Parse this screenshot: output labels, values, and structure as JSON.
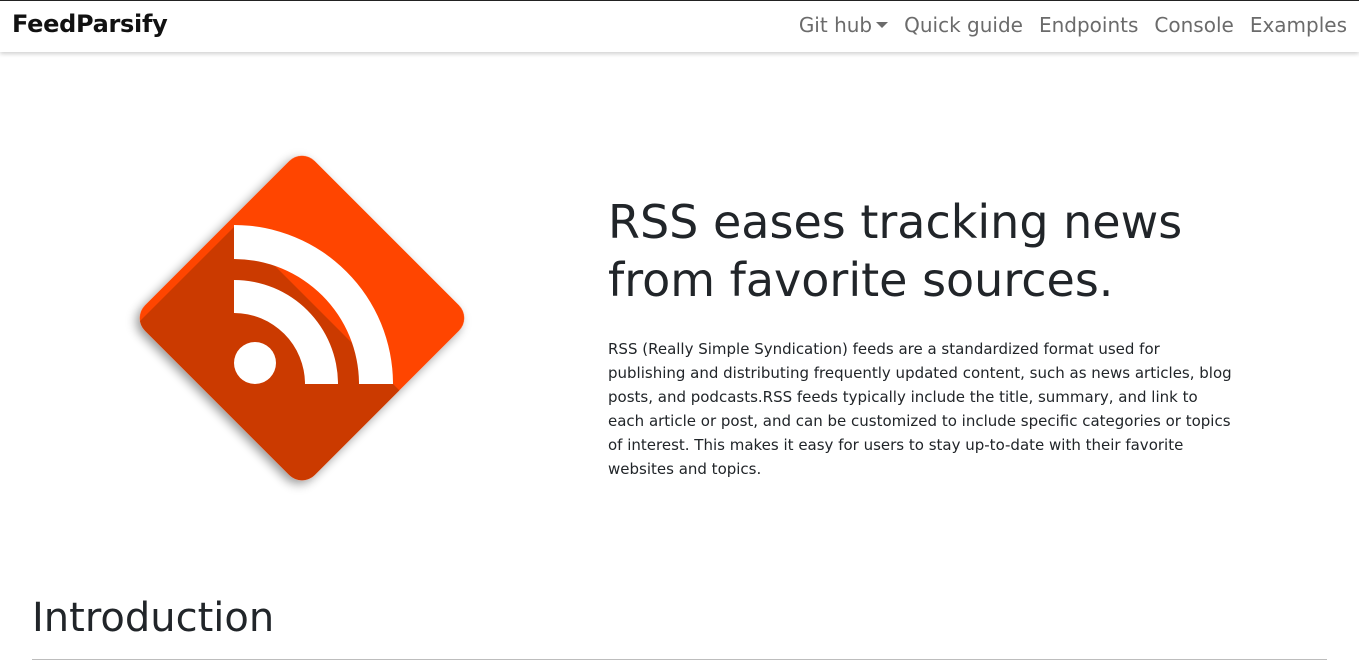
{
  "navbar": {
    "brand": "FeedParsify",
    "links": [
      {
        "label": "Git hub",
        "dropdown": true
      },
      {
        "label": "Quick guide"
      },
      {
        "label": "Endpoints"
      },
      {
        "label": "Console"
      },
      {
        "label": "Examples"
      }
    ]
  },
  "hero": {
    "logo_icon": "rss-feed-icon",
    "logo_color": "#FF4500",
    "title_line1": "RSS eases tracking news",
    "title_line2": "from favorite sources.",
    "description": "RSS (Really Simple Syndication) feeds are a standardized format used for publishing and distributing frequently updated content, such as news articles, blog posts, and podcasts.RSS feeds typically include the title, summary, and link to each article or post, and can be customized to include specific categories or topics of interest. This makes it easy for users to stay up-to-date with their favorite websites and topics."
  },
  "sections": {
    "introduction_title": "Introduction"
  }
}
